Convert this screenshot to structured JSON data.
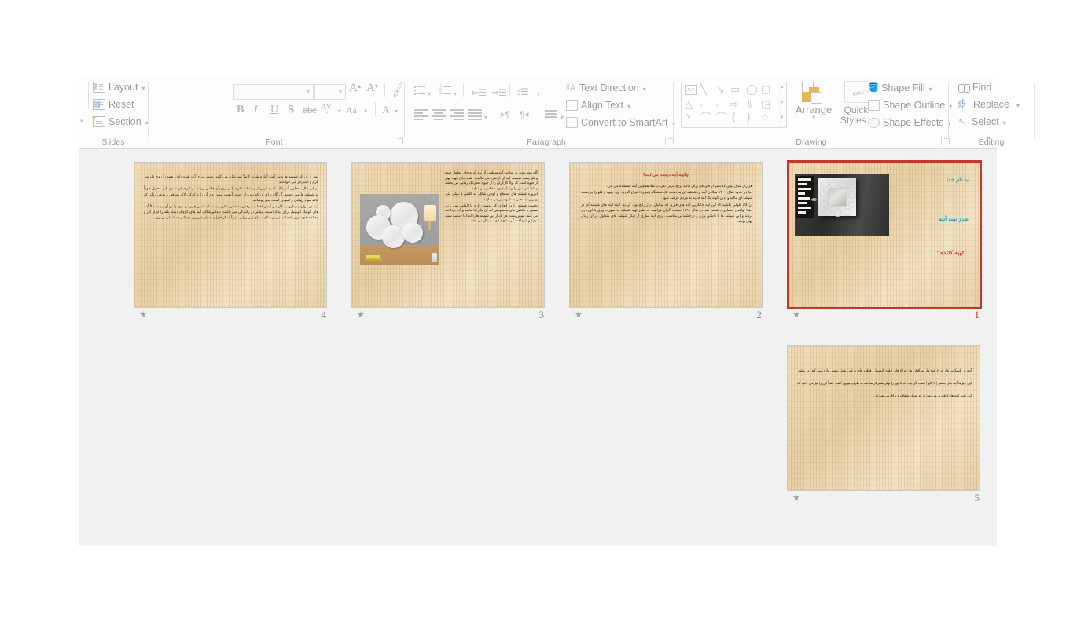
{
  "app": {
    "name": "PowerPoint Slide Sorter"
  },
  "ribbon": {
    "groups": [
      {
        "label": "Slides"
      },
      {
        "label": "Font"
      },
      {
        "label": "Paragraph"
      },
      {
        "label": "Drawing"
      },
      {
        "label": "Editing"
      }
    ],
    "slides_group": {
      "layout_label": "Layout",
      "reset_label": "Reset",
      "section_label": "Section",
      "layout_icon": "layout-icon",
      "reset_icon": "reset-icon",
      "section_icon": "section-icon"
    },
    "font_group": {
      "font_name_value": "",
      "font_name_placeholder": "",
      "font_size_value": "",
      "grow_font_label": "A",
      "shrink_font_label": "A",
      "clear_formatting_icon": "clear-formatting-icon",
      "bold_label": "B",
      "italic_label": "I",
      "underline_label": "U",
      "shadow_label": "S",
      "strikethrough_label": "abc",
      "character_spacing_label": "AV",
      "change_case_label": "Aa",
      "font_color_label": "A"
    },
    "paragraph_group": {
      "text_direction_label": "Text Direction",
      "align_text_label": "Align Text",
      "convert_to_smartart_label": "Convert to SmartArt",
      "bullets_icon": "bullets-icon",
      "numbering_icon": "numbering-icon",
      "decrease_indent_icon": "decrease-indent-icon",
      "increase_indent_icon": "increase-indent-icon",
      "line_spacing_icon": "line-spacing-icon",
      "align_left_icon": "align-left-icon",
      "align_center_icon": "align-center-icon",
      "align_right_icon": "align-right-icon",
      "justify_icon": "justify-icon",
      "ltr_icon": "text-direction-ltr-icon",
      "rtl_icon": "text-direction-rtl-icon",
      "columns_icon": "columns-icon"
    },
    "drawing_group": {
      "arrange_label": "Arrange",
      "quick_styles_label_line1": "Quick",
      "quick_styles_label_line2": "Styles",
      "shape_fill_label": "Shape Fill",
      "shape_outline_label": "Shape Outline",
      "shape_effects_label": "Shape Effects",
      "shapes": [
        "textbox-shape",
        "line-shape",
        "arrow-shape",
        "rectangle-shape",
        "oval-shape",
        "rounded-rectangle-shape",
        "triangle-shape",
        "elbow-connector-shape",
        "elbow-arrow-shape",
        "right-arrow-shape",
        "down-arrow-shape",
        "folded-corner-shape",
        "scribble-shape",
        "curve-shape",
        "arc-shape",
        "left-brace-shape",
        "right-brace-shape",
        "star-shape"
      ]
    },
    "editing_group": {
      "find_label": "Find",
      "replace_label": "Replace",
      "select_label": "Select",
      "find_icon": "find-icon",
      "replace_icon": "replace-icon",
      "select_icon": "select-icon"
    },
    "collapse_ribbon_icon": "chevron-up-icon"
  },
  "slides": [
    {
      "number": "4",
      "selected": false,
      "animation_marker": "★",
      "has_photo": false,
      "title": "",
      "body": [
        "پس از آن که شیشه ها بدین گونه آماده شدند کاملاً تمیزشان می کنند، سپس برای آب نقره دادن، همه را روی یک میز گرم و استردار می خوابانند.",
        "در این حال، محلول آمونیاک، اسید تارتریک و نیترات نقره را بر روی آن ها می ریزند. بر اثر حرارت میز، این محلول فوراً به شیشه ها می چسبد. آن گاه برای آن که نقره از چیزی آسیب نبیند روی آن را با اندکی لاک صدفی و نوعی رنگ، که فاقد مواد روغنی و اسیدی است، می پوشانند.",
        "آینه در موارد بسیاری به کار می آید و فقط مصرفش منحصر به این نیست که کسی چهره ی خود را در آن ببیند، مثلاً آینه های کوچک اتومبیل برای ایجاد امنیت بیشتر در رانندگی می باشند. دندانپزشکان آینه های کوچک دسته بلند را ابزار کار و معالجه خود قرار داده اند. در پریسکوپ های زیردریایی، نیز آینه از اجزای بسیار ضروری دیدبانی به شمار می رود."
      ]
    },
    {
      "number": "3",
      "selected": false,
      "animation_marker": "★",
      "has_photo": true,
      "photo_name": "round-mirrors-photo",
      "title": "",
      "body": [
        "گام مهم بعدی در ساخت آینه سطحی آن بود که به جای محلول جیوه و قلع پشت شیشه، لایه ای از نقره می مالیدند. نقره بدان جهت بهتر از جیوه است که اولاً کارگران را از جیوه خطرناک رهایی می بخشد و ثانیاً نقره نور را بهتر از جیوه منعکس می نماید.",
        "امروزه شیشه های مسطح و لوحی شکل، به کلفتی ۵ میلی متر، بهترین آینه ها را به شیوه زیر می سازند:",
        "نخست شیشه را در ابعادی که دوست دارند با الماس می برند. سپس با ماشین های مخصوصی لبه آن ها را با ماسه و آب پرداخت می کنند. سپس پشت هر یک از این شیشه ها را ابتدا با «ماسه سنگ نرم» و «پرداخت گر نمدی» خوب صیقل می دهند."
      ]
    },
    {
      "number": "2",
      "selected": false,
      "animation_marker": "★",
      "has_photo": false,
      "title": "چگونه آینه درست می کنند؟",
      "body": [
        "هزاران سال پیش که بشر از فلزهای براق مانند برنج، برنز، نقره یا طلا همچون آینه استفاده می کرد.",
        "اما در حدود سال ۱۳۰۰ میلادی آینه ی شیشه ای به دست یک صنعتگر ونیزی اختراع گردید. وی جیوه و قلع را بر پشت شیشه ای مالید و بدین گونه یک آینه جدید به مردم عرضه نمود.",
        "آن گاه طولی نکشید که این آینه جایگزین آینه های فلزی که سالیان دراز رایج بود، گردید. البته آینه های شیشه ای در ابتدا نواقص بسیاری داشتند. بعد در سال ۱۶۹۱ صنعت گران فرانسه به طرز تهیه شیشه به صورت ورق یا لوح، پی بردند و این شیشه ها با داشتن وزن و درخشندگی مناسب، برای آینه سازی از دیگر شیشه های متداول در آن زمان بهتر بودند."
      ]
    },
    {
      "number": "1",
      "selected": true,
      "animation_marker": "★",
      "has_photo": true,
      "photo_name": "ornate-mirror-photo",
      "title": "",
      "lines": [
        {
          "text": "به نام خدا",
          "color": "#18a6c8"
        },
        {
          "text": "طرز تهیه آینه",
          "color": "#18a6c8"
        },
        {
          "text": "تهیه کننده :",
          "color": "#c0392b"
        }
      ],
      "body": []
    },
    {
      "number": "5",
      "selected": false,
      "animation_marker": "★",
      "has_photo": false,
      "title": "",
      "body": [
        "آینه در تلسکوپ ها، چراغ قوه ها، نورافکن ها، چراغ های جلوی اتومبیل، قطب های دریایی نقش مهمی بازی می کند. در بیشتر این چیزها آینه های مقعر ( یا کاو ) نصب گردیده اند تا نور را بهتر متمرکز ساخته به طرف بیرون کنند. حتماً این را نیز می دانید که این گونه آینه ها را طوری می سازند که بسیار شفاف و براق می سازند."
      ]
    }
  ],
  "colors": {
    "selection_border": "#c0392b",
    "slide_bg": "#ecd6af",
    "sorter_bg": "#f1f1f1",
    "ribbon_text": "#9b9b9b",
    "title_red": "#c0392b",
    "cyan": "#18a6c8"
  }
}
